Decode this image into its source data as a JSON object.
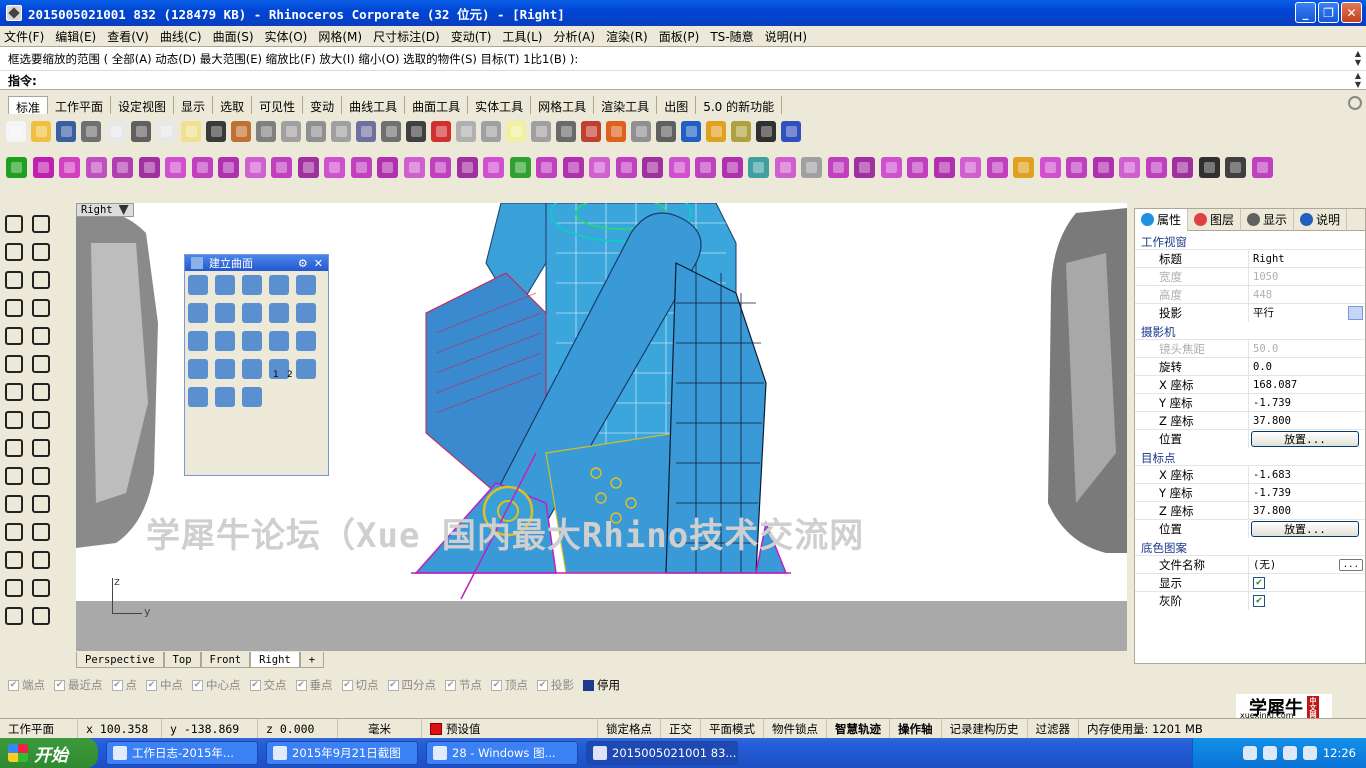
{
  "window": {
    "title": "2015005021001 832 (128479 KB) - Rhinoceros Corporate (32 位元) - [Right]"
  },
  "menu": [
    "文件(F)",
    "编辑(E)",
    "查看(V)",
    "曲线(C)",
    "曲面(S)",
    "实体(O)",
    "网格(M)",
    "尺寸标注(D)",
    "变动(T)",
    "工具(L)",
    "分析(A)",
    "渲染(R)",
    "面板(P)",
    "TS-随意",
    "说明(H)"
  ],
  "command": {
    "history": "框选要缩放的范围 ( 全部(A)  动态(D)  最大范围(E)  缩放比(F)  放大(I)  缩小(O)  选取的物件(S)  目标(T)  1比1(B) ):",
    "prompt": "指令:"
  },
  "toolbar_tabs": [
    "标准",
    "工作平面",
    "设定视图",
    "显示",
    "选取",
    "可见性",
    "变动",
    "曲线工具",
    "曲面工具",
    "实体工具",
    "网格工具",
    "渲染工具",
    "出图",
    "5.0 的新功能"
  ],
  "toolbar_colors": {
    "standard": [
      "#f5f5f5",
      "#f0c040",
      "#3a5fa0",
      "#707070",
      "#e8e8e8",
      "#606060",
      "#e8e8e8",
      "#f0e090",
      "#3a3a3a",
      "#c07030",
      "#808080",
      "#a0a0a0",
      "#909090",
      "#a0a0a0",
      "#7070a0",
      "#707070",
      "#404040",
      "#d03030",
      "#b0b0b0",
      "#a0a0a0",
      "#f0f0a0",
      "#a0a0a0",
      "#6a6a6a",
      "#c04030",
      "#e06020",
      "#909090",
      "#606060",
      "#2060c0",
      "#e0a020",
      "#b0a040",
      "#303030",
      "#3050c0"
    ],
    "surface": [
      "#20a020",
      "#c020b0",
      "#d040c0",
      "#c050c0",
      "#b040b0",
      "#a030a0",
      "#d050d0",
      "#c040c0",
      "#b030b0",
      "#d060d0",
      "#c040c0",
      "#a030a0",
      "#d050d0",
      "#c040c0",
      "#b030b0",
      "#d060d0",
      "#c040c0",
      "#a030a0",
      "#d050d0",
      "#30a030",
      "#c040c0",
      "#b030b0",
      "#d060d0",
      "#c040c0",
      "#a030a0",
      "#d050d0",
      "#c040c0",
      "#b030b0",
      "#40a0a0",
      "#d060d0",
      "#a0a0a0",
      "#c040c0",
      "#a030a0",
      "#d050d0",
      "#c040c0",
      "#b030b0",
      "#d060d0",
      "#c040c0",
      "#e0a020",
      "#d050d0",
      "#c040c0",
      "#b030b0",
      "#d060d0",
      "#c040c0",
      "#a030a0",
      "#303030",
      "#404040",
      "#c040c0"
    ]
  },
  "viewport": {
    "label": "Right",
    "watermark": "学犀牛论坛（Xue                    国内最大Rhino技术交流网",
    "axis_z": "z",
    "axis_y": "y"
  },
  "palette": {
    "title": "建立曲面",
    "count": 23,
    "marks": [
      "1",
      "2"
    ]
  },
  "viewport_tabs": [
    "Perspective",
    "Top",
    "Front",
    "Right",
    "+"
  ],
  "osnap": [
    {
      "label": "端点",
      "checked": false
    },
    {
      "label": "最近点",
      "checked": false
    },
    {
      "label": "点",
      "checked": false
    },
    {
      "label": "中点",
      "checked": false
    },
    {
      "label": "中心点",
      "checked": false
    },
    {
      "label": "交点",
      "checked": false
    },
    {
      "label": "垂点",
      "checked": false
    },
    {
      "label": "切点",
      "checked": false
    },
    {
      "label": "四分点",
      "checked": false
    },
    {
      "label": "节点",
      "checked": false
    },
    {
      "label": "顶点",
      "checked": false
    },
    {
      "label": "投影",
      "checked": false
    },
    {
      "label": "停用",
      "checked": true
    }
  ],
  "status": {
    "cplane": "工作平面",
    "x": "x 100.358",
    "y": "y -138.869",
    "z": "z 0.000",
    "units": "毫米",
    "layer": "预设值",
    "grid_snap": "锁定格点",
    "ortho": "正交",
    "planar": "平面模式",
    "osnap": "物件锁点",
    "smarttrack": "智慧轨迹",
    "gumball": "操作轴",
    "history": "记录建构历史",
    "filter": "过滤器",
    "memory": "内存使用量: 1201 MB"
  },
  "side_panel": {
    "tabs": [
      "属性",
      "图层",
      "显示",
      "说明"
    ],
    "sections": {
      "viewport": "工作视窗",
      "camera": "摄影机",
      "target": "目标点",
      "background": "底色图案"
    },
    "viewport_props": [
      {
        "k": "标题",
        "v": "Right",
        "disabled": false
      },
      {
        "k": "宽度",
        "v": "1050",
        "disabled": true
      },
      {
        "k": "高度",
        "v": "448",
        "disabled": true
      },
      {
        "k": "投影",
        "v": "平行",
        "disabled": false
      }
    ],
    "camera_props": [
      {
        "k": "镜头焦距",
        "v": "50.0",
        "disabled": true
      },
      {
        "k": "旋转",
        "v": "0.0",
        "disabled": false
      },
      {
        "k": "X 座标",
        "v": "168.087",
        "disabled": false
      },
      {
        "k": "Y 座标",
        "v": "-1.739",
        "disabled": false
      },
      {
        "k": "Z 座标",
        "v": "37.800",
        "disabled": false
      }
    ],
    "position_label": "位置",
    "place_button": "放置...",
    "target_props": [
      {
        "k": "X 座标",
        "v": "-1.683",
        "disabled": false
      },
      {
        "k": "Y 座标",
        "v": "-1.739",
        "disabled": false
      },
      {
        "k": "Z 座标",
        "v": "37.800",
        "disabled": false
      }
    ],
    "background_props": {
      "filename_label": "文件名称",
      "filename_value": "(无)",
      "filename_browse": "...",
      "show_label": "显示",
      "gray_label": "灰阶"
    }
  },
  "taskbar": {
    "start": "开始",
    "tasks": [
      {
        "label": "工作日志-2015年...",
        "active": false
      },
      {
        "label": "2015年9月21日截图",
        "active": false
      },
      {
        "label": "28 - Windows 图...",
        "active": false
      },
      {
        "label": "2015005021001 83...",
        "active": true
      }
    ],
    "clock": "12:26"
  },
  "logo": {
    "text": "学犀牛",
    "sub": "xuexiniu.com",
    "badge": "中文网"
  }
}
